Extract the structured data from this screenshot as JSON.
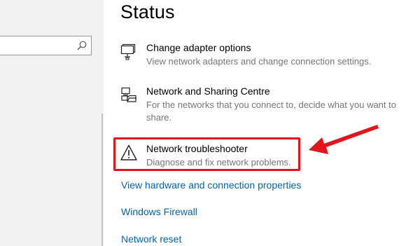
{
  "window": {
    "title": "Status"
  },
  "search": {
    "value": "",
    "icon": "search-icon"
  },
  "entries": [
    {
      "icon": "network-adapter-icon",
      "title": "Change adapter options",
      "description": "View network adapters and change connection settings."
    },
    {
      "icon": "sharing-centre-icon",
      "title": "Network and Sharing Centre",
      "description": "For the networks that you connect to, decide what you want to share."
    },
    {
      "icon": "warning-triangle-icon",
      "title": "Network troubleshooter",
      "description": "Diagnose and fix network problems."
    }
  ],
  "links": [
    "View hardware and connection properties",
    "Windows Firewall",
    "Network reset"
  ],
  "annotation": {
    "color": "#e4141b",
    "target": "Network troubleshooter"
  },
  "colors": {
    "link": "#0063b1",
    "description": "#767676",
    "nav_background": "#f2f2f2"
  }
}
